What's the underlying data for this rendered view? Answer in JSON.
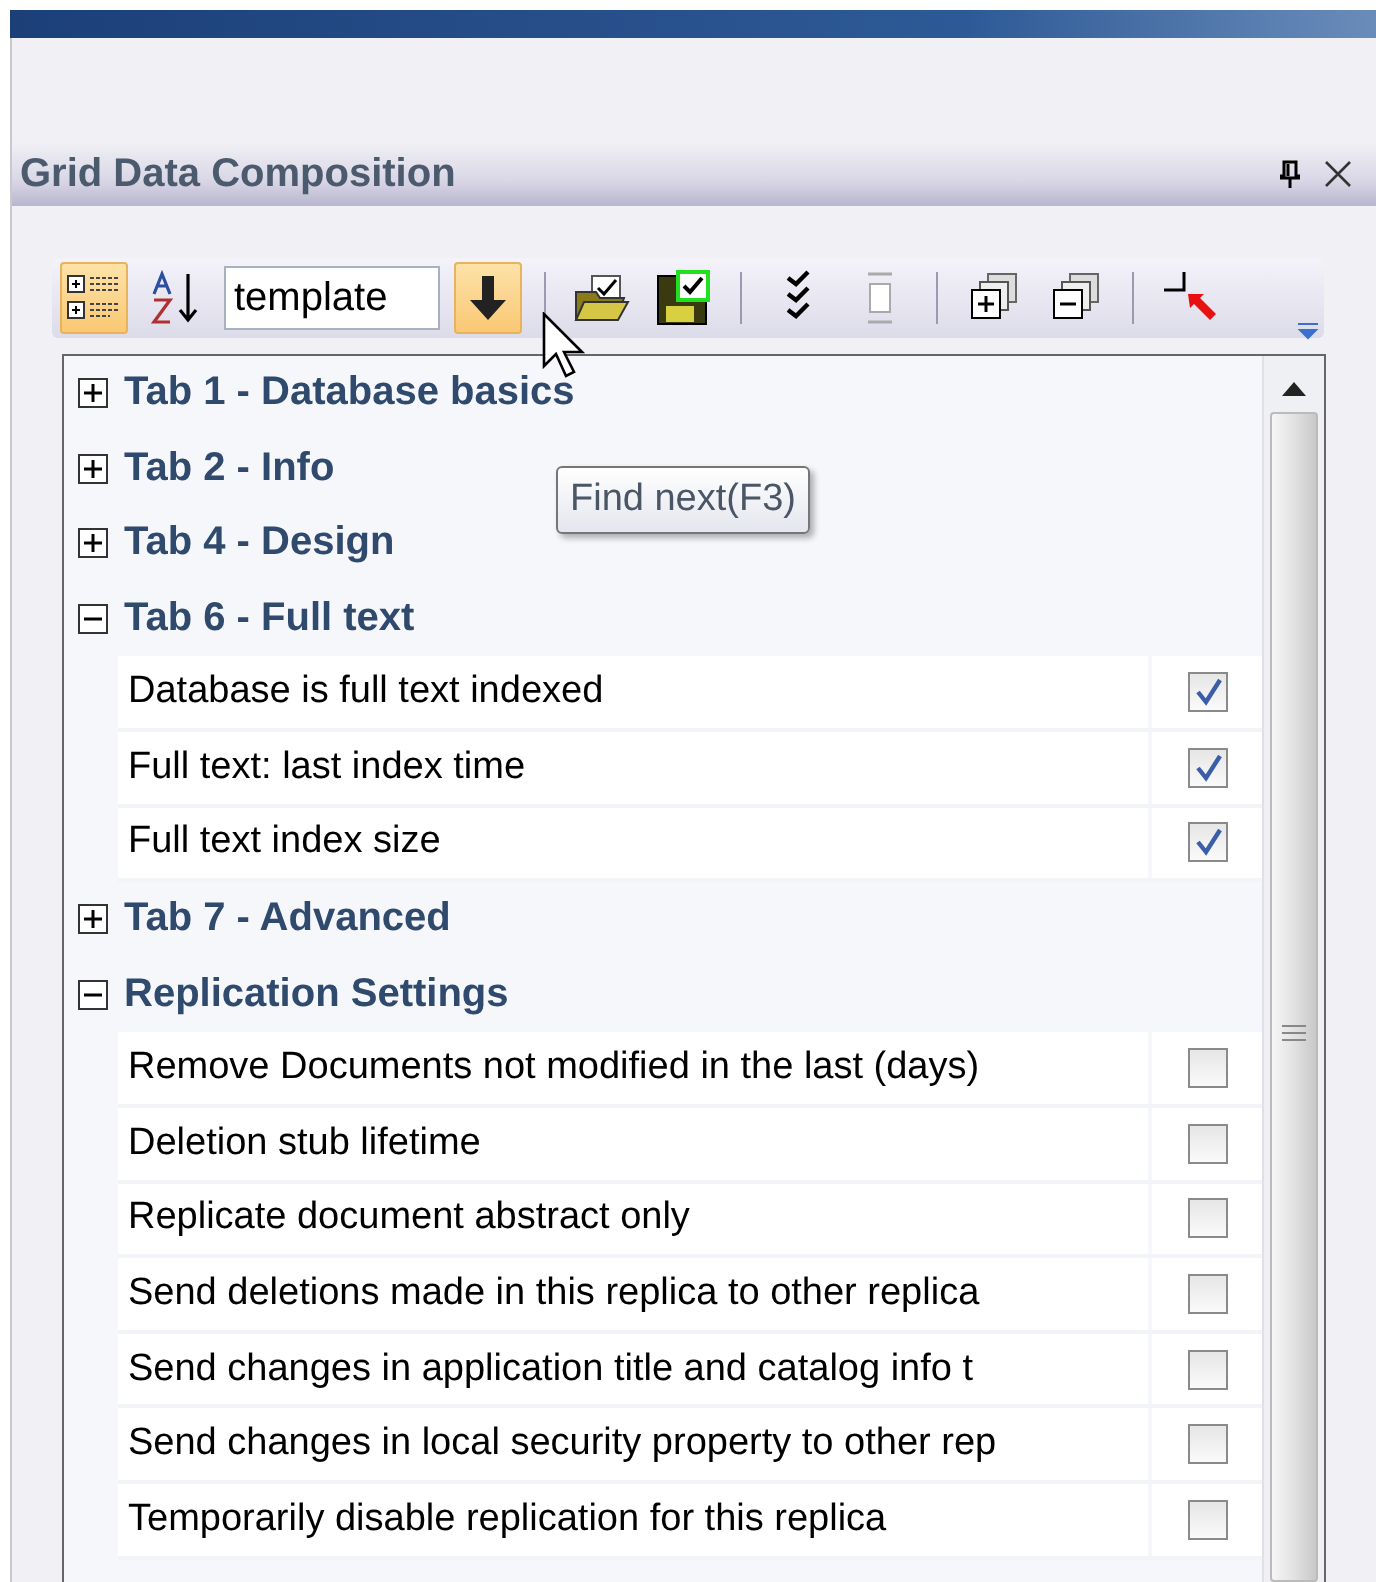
{
  "panel": {
    "title": "Grid Data Composition"
  },
  "toolbar": {
    "search": {
      "value": "template"
    },
    "buttons": [
      {
        "kind": "categorized",
        "selected": true
      },
      {
        "kind": "sort"
      },
      {
        "kind": "search"
      },
      {
        "kind": "find-next",
        "selected": true
      },
      {
        "kind": "separator"
      },
      {
        "kind": "open"
      },
      {
        "kind": "save"
      },
      {
        "kind": "separator"
      },
      {
        "kind": "checks"
      },
      {
        "kind": "frame",
        "disabled": true
      },
      {
        "kind": "separator"
      },
      {
        "kind": "expand-all"
      },
      {
        "kind": "collapse-all"
      },
      {
        "kind": "separator"
      },
      {
        "kind": "pointer"
      }
    ]
  },
  "tooltip": "Find next(F3)",
  "groups": [
    {
      "title": "Tab 1 - Database basics",
      "expanded": false
    },
    {
      "title": "Tab 2 - Info",
      "expanded": false
    },
    {
      "title": "Tab 4 - Design",
      "expanded": false
    },
    {
      "title": "Tab 6 - Full text",
      "expanded": true,
      "children": [
        {
          "label": "Database is full text indexed",
          "checked": true
        },
        {
          "label": "Full text: last index time",
          "checked": true
        },
        {
          "label": "Full text index size",
          "checked": true
        }
      ]
    },
    {
      "title": "Tab 7 - Advanced",
      "expanded": false
    },
    {
      "title": "Replication Settings",
      "expanded": true,
      "children": [
        {
          "label": "Remove Documents not modified in the last (days)",
          "checked": false
        },
        {
          "label": "Deletion stub lifetime",
          "checked": false
        },
        {
          "label": "Replicate document abstract only",
          "checked": false
        },
        {
          "label": "Send deletions made in this replica to other replica",
          "checked": false
        },
        {
          "label": "Send changes in application title and catalog info t",
          "checked": false
        },
        {
          "label": "Send changes in local security property to other rep",
          "checked": false
        },
        {
          "label": "Temporarily disable replication for this replica",
          "checked": false
        }
      ]
    }
  ]
}
